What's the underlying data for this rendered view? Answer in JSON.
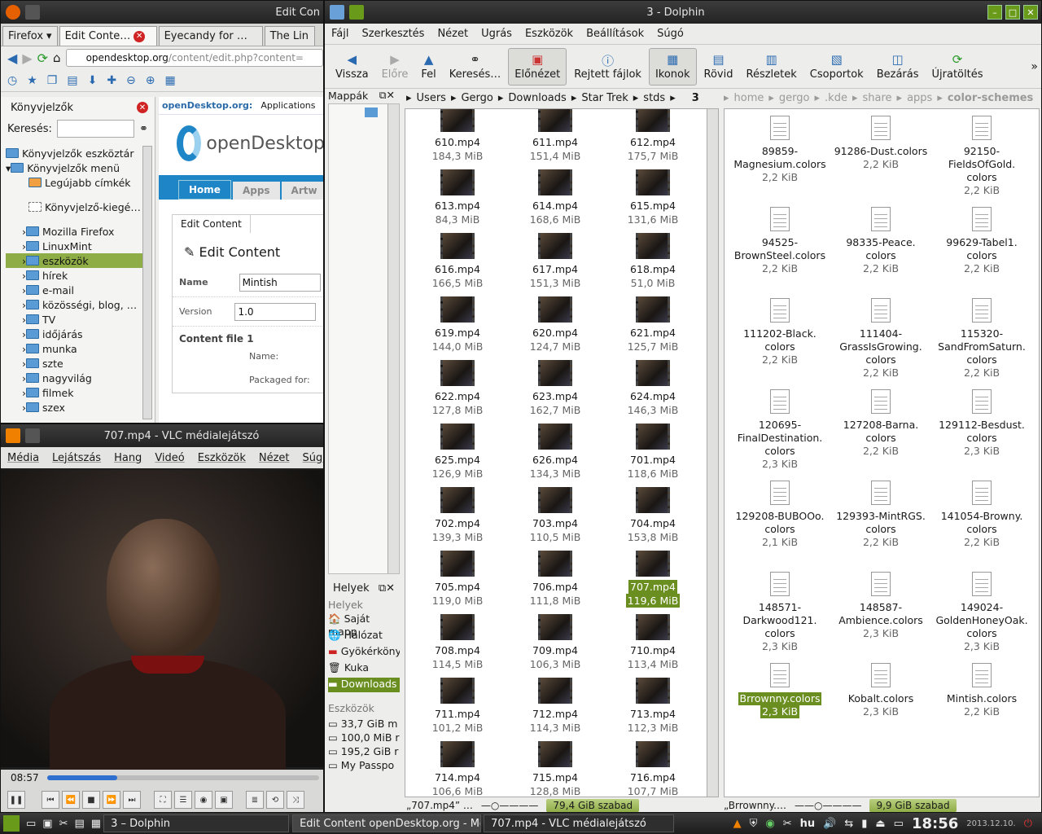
{
  "firefox": {
    "title": "Edit  Con",
    "menu_label": "Firefox",
    "tabs": [
      "Edit  Conte…",
      "Eyecandy for …",
      "The Lin"
    ],
    "url_host": "opendesktop.org",
    "url_path": "/content/edit.php?content=",
    "sidebar_title": "Könyvjelzők",
    "search_label": "Keresés:",
    "tree": [
      "Könyvjelzők eszköztár",
      "Könyvjelzők menü",
      "Legújabb címkék",
      "Könyvjelző-kiegé…",
      "Mozilla Firefox",
      "LinuxMint",
      "eszközök",
      "hírek",
      "e-mail",
      "közösségi, blog, …",
      "TV",
      "időjárás",
      "munka",
      "szte",
      "nagyvilág",
      "filmek",
      "szex"
    ],
    "page": {
      "site": "openDesktop.org:",
      "section": "Applications",
      "logo": "openDesktop",
      "nav": [
        "Home",
        "Apps",
        "Artw"
      ],
      "tab": "Edit  Content",
      "heading": "Edit Content",
      "name_label": "Name",
      "name_value": "Mintish",
      "version_label": "Version",
      "version_value": "1.0",
      "file_label": "Content file 1",
      "file_name": "Name:",
      "packaged": "Packaged for:"
    }
  },
  "vlc": {
    "title": "707.mp4 - VLC médialejátszó",
    "menu": [
      "Média",
      "Lejátszás",
      "Hang",
      "Videó",
      "Eszközök",
      "Nézet",
      "Súgó"
    ],
    "time": "08:57",
    "progress": 0.26
  },
  "dolphin": {
    "title": "3 - Dolphin",
    "menu": [
      "Fájl",
      "Szerkesztés",
      "Nézet",
      "Ugrás",
      "Eszközök",
      "Beállítások",
      "Súgó"
    ],
    "toolbar": [
      "Vissza",
      "Előre",
      "Fel",
      "Keresés…",
      "Előnézet",
      "Rejtett fájlok",
      "Ikonok",
      "Rövid",
      "Részletek",
      "Csoportok",
      "Bezárás",
      "Újratöltés"
    ],
    "folders_label": "Mappák",
    "places_label": "Helyek",
    "places_header": "Helyek",
    "places": [
      "Saját mapp",
      "Hálózat",
      "Gyökérköny",
      "Kuka",
      "Downloads"
    ],
    "tools_header": "Eszközök",
    "devices": [
      "33,7 GiB m",
      "100,0 MiB r",
      "195,2 GiB r",
      "My Passpo"
    ],
    "left_crumbs": [
      "Users",
      "Gergo",
      "Downloads",
      "Star Trek",
      "stds",
      "3"
    ],
    "right_crumbs": [
      "home",
      "gergo",
      ".kde",
      "share",
      "apps",
      "color-schemes"
    ],
    "videos": [
      [
        "610.mp4",
        "184,3 MiB"
      ],
      [
        "611.mp4",
        "151,4 MiB"
      ],
      [
        "612.mp4",
        "175,7 MiB"
      ],
      [
        "613.mp4",
        "84,3 MiB"
      ],
      [
        "614.mp4",
        "168,6 MiB"
      ],
      [
        "615.mp4",
        "131,6 MiB"
      ],
      [
        "616.mp4",
        "166,5 MiB"
      ],
      [
        "617.mp4",
        "151,3 MiB"
      ],
      [
        "618.mp4",
        "51,0 MiB"
      ],
      [
        "619.mp4",
        "144,0 MiB"
      ],
      [
        "620.mp4",
        "124,7 MiB"
      ],
      [
        "621.mp4",
        "125,7 MiB"
      ],
      [
        "622.mp4",
        "127,8 MiB"
      ],
      [
        "623.mp4",
        "162,7 MiB"
      ],
      [
        "624.mp4",
        "146,3 MiB"
      ],
      [
        "625.mp4",
        "126,9 MiB"
      ],
      [
        "626.mp4",
        "134,3 MiB"
      ],
      [
        "701.mp4",
        "118,6 MiB"
      ],
      [
        "702.mp4",
        "139,3 MiB"
      ],
      [
        "703.mp4",
        "110,5 MiB"
      ],
      [
        "704.mp4",
        "153,8 MiB"
      ],
      [
        "705.mp4",
        "119,0 MiB"
      ],
      [
        "706.mp4",
        "111,8 MiB"
      ],
      [
        "707.mp4",
        "119,6 MiB"
      ],
      [
        "708.mp4",
        "114,5 MiB"
      ],
      [
        "709.mp4",
        "106,3 MiB"
      ],
      [
        "710.mp4",
        "113,4 MiB"
      ],
      [
        "711.mp4",
        "101,2 MiB"
      ],
      [
        "712.mp4",
        "114,3 MiB"
      ],
      [
        "713.mp4",
        "112,3 MiB"
      ],
      [
        "714.mp4",
        "106,6 MiB"
      ],
      [
        "715.mp4",
        "128,8 MiB"
      ],
      [
        "716.mp4",
        "107,7 MiB"
      ]
    ],
    "selected_video": "707.mp4",
    "colors": [
      [
        "89859-\nMagnesium.colors",
        "2,2 KiB"
      ],
      [
        "91286-Dust.colors",
        "2,2 KiB"
      ],
      [
        "92150-\nFieldsOfGold.\ncolors",
        "2,2 KiB"
      ],
      [
        "94525-\nBrownSteel.colors",
        "2,2 KiB"
      ],
      [
        "98335-Peace.\ncolors",
        "2,2 KiB"
      ],
      [
        "99629-Tabel1.\ncolors",
        "2,2 KiB"
      ],
      [
        "111202-Black.\ncolors",
        "2,2 KiB"
      ],
      [
        "111404-\nGrassIsGrowing.\ncolors",
        "2,2 KiB"
      ],
      [
        "115320-\nSandFromSaturn.\ncolors",
        "2,2 KiB"
      ],
      [
        "120695-\nFinalDestination.\ncolors",
        "2,3 KiB"
      ],
      [
        "127208-Barna.\ncolors",
        "2,2 KiB"
      ],
      [
        "129112-Besdust.\ncolors",
        "2,3 KiB"
      ],
      [
        "129208-BUBOOo.\ncolors",
        "2,1 KiB"
      ],
      [
        "129393-MintRGS.\ncolors",
        "2,2 KiB"
      ],
      [
        "141054-Browny.\ncolors",
        "2,2 KiB"
      ],
      [
        "148571-\nDarkwood121.\ncolors",
        "2,3 KiB"
      ],
      [
        "148587-\nAmbience.colors",
        "2,3 KiB"
      ],
      [
        "149024-\nGoldenHoneyOak.\ncolors",
        "2,3 KiB"
      ],
      [
        "Brrownny.colors",
        "2,3 KiB"
      ],
      [
        "Kobalt.colors",
        "2,3 KiB"
      ],
      [
        "Mintish.colors",
        "2,2 KiB"
      ]
    ],
    "selected_color": "Brrownny.colors",
    "status_left": "„707.mp4” …",
    "free_left": "79,4 GiB szabad",
    "status_right": "„Brrownny.…",
    "free_right": "9,9 GiB szabad"
  },
  "taskbar": {
    "items": [
      "3 – Dolphin",
      "Edit  Content openDesktop.org - Mo",
      "707.mp4 - VLC médialejátszó"
    ],
    "lang": "hu",
    "time": "18:56",
    "date": "2013.12.10."
  },
  "colors": {
    "accent": "#8fad47",
    "selected": "#6a8e20",
    "link": "#1e86c6"
  }
}
